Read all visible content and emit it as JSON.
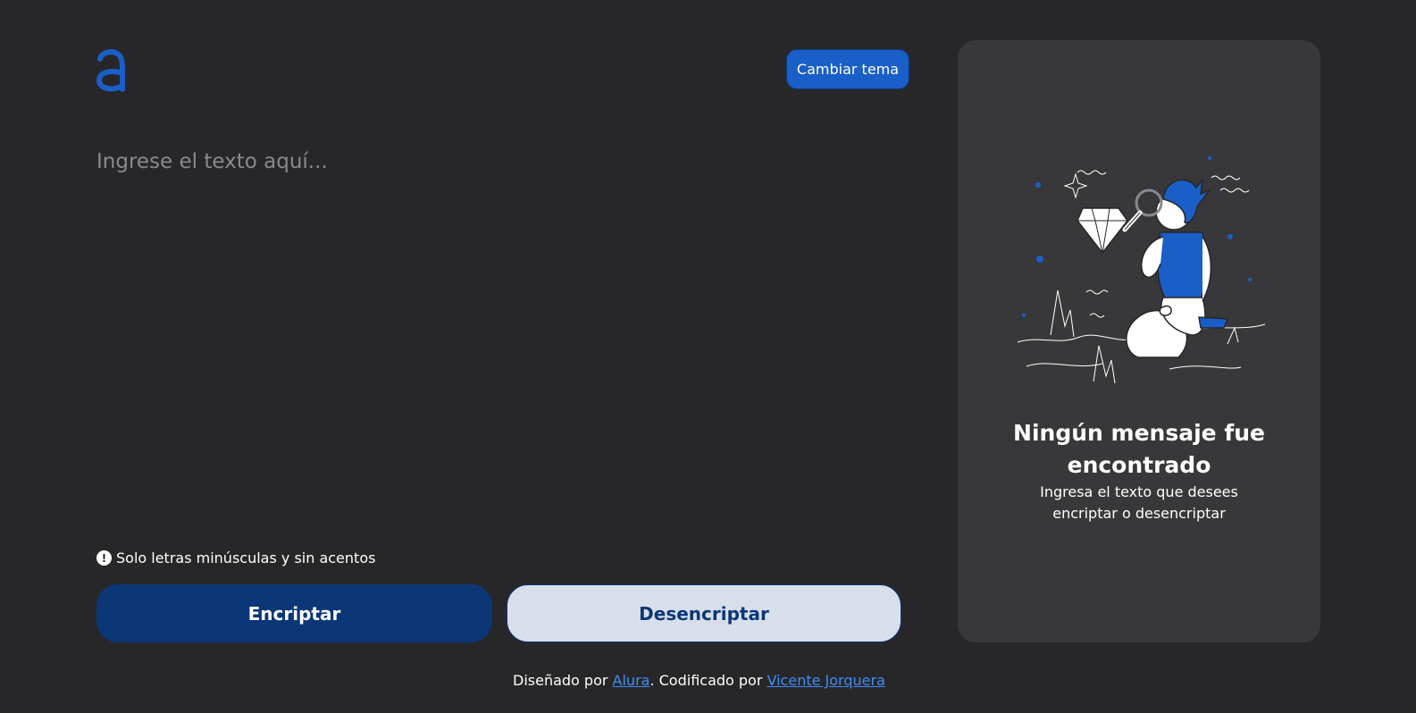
{
  "header": {
    "logo_icon": "alura-logo-icon",
    "theme_button_label": "Cambiar tema"
  },
  "editor": {
    "placeholder": "Ingrese el texto aquí..."
  },
  "hint": {
    "icon": "exclamation-circle-icon",
    "text": "Solo letras minúsculas y sin acentos"
  },
  "actions": {
    "encrypt_label": "Encriptar",
    "decrypt_label": "Desencriptar"
  },
  "footer": {
    "designed_by_prefix": "Diseñado por ",
    "designer_link": "Alura",
    "coded_by_prefix": ". Codificado por ",
    "coder_link": "Vicente Jorquera"
  },
  "result_panel": {
    "illustration": "person-with-magnifier-and-diamond-illustration",
    "title": "Ningún mensaje fue encontrado",
    "description": "Ingresa el texto que desees encriptar o desencriptar"
  },
  "colors": {
    "background": "#27272a",
    "panel": "#38383b",
    "accent": "#1a5fc8",
    "primary_button": "#0b3777",
    "secondary_button": "#d8dfeb",
    "link": "#3f8cf3"
  }
}
